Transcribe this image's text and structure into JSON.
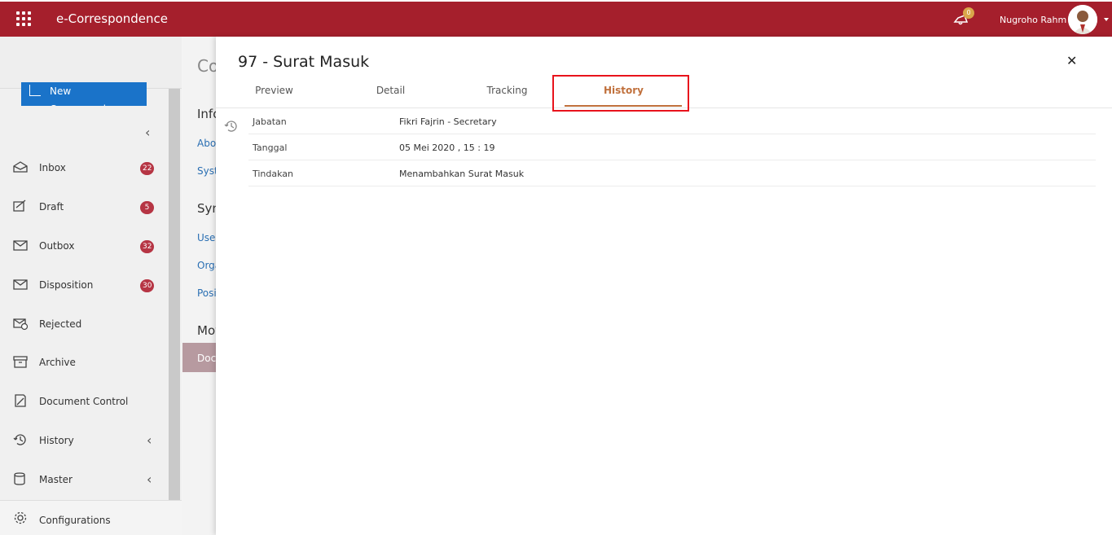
{
  "app": {
    "title": "e-Correspondence"
  },
  "header": {
    "notification_count": "0",
    "user_name": "Nugroho Rahm"
  },
  "sidebar": {
    "new_button": "New Correspondence",
    "items": [
      {
        "label": "Inbox",
        "badge": "22",
        "icon": "inbox-icon"
      },
      {
        "label": "Draft",
        "badge": "5",
        "icon": "draft-icon"
      },
      {
        "label": "Outbox",
        "badge": "32",
        "icon": "outbox-icon"
      },
      {
        "label": "Disposition",
        "badge": "30",
        "icon": "disposition-icon"
      },
      {
        "label": "Rejected",
        "badge": "",
        "icon": "rejected-icon"
      },
      {
        "label": "Archive",
        "badge": "",
        "icon": "archive-icon"
      },
      {
        "label": "Document Control",
        "badge": "",
        "icon": "document-control-icon"
      },
      {
        "label": "History",
        "badge": "",
        "icon": "history-icon"
      },
      {
        "label": "Master",
        "badge": "",
        "icon": "master-icon"
      }
    ],
    "configurations": "Configurations"
  },
  "background_page": {
    "title": "Co",
    "section1": "Info",
    "link1": "Abou",
    "link2": "Syste",
    "section2": "Syn",
    "link3": "User",
    "link4": "Orga",
    "link5": "Positi",
    "section3": "Mov",
    "selected": "Docu"
  },
  "drawer": {
    "title": "97 - Surat Masuk",
    "tabs": [
      "Preview",
      "Detail",
      "Tracking",
      "History"
    ],
    "active_tab": "History",
    "history": [
      {
        "key": "Jabatan",
        "value": "Fikri Fajrin - Secretary"
      },
      {
        "key": "Tanggal",
        "value": "05 Mei 2020 , 15 : 19"
      },
      {
        "key": "Tindakan",
        "value": "Menambahkan Surat Masuk"
      }
    ]
  },
  "colors": {
    "brand": "#a51f2c",
    "accent": "#c0703c",
    "button": "#1a73c9",
    "badge": "#b63544"
  }
}
